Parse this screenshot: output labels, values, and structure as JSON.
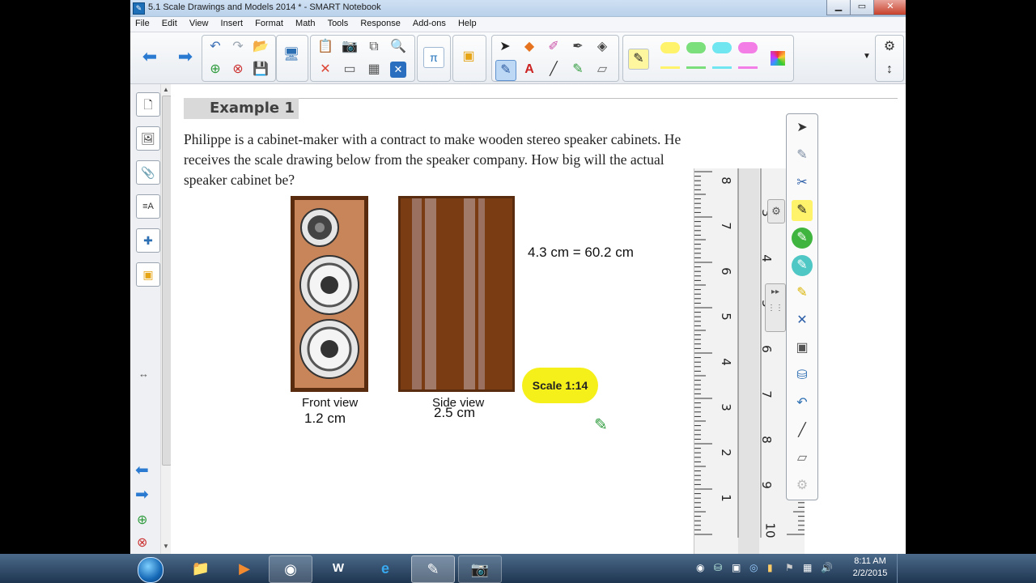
{
  "window": {
    "title": "5.1  Scale Drawings and Models 2014 * - SMART Notebook",
    "minimize": "▁",
    "restore": "▭",
    "close": "✕"
  },
  "menu": [
    "File",
    "Edit",
    "View",
    "Insert",
    "Format",
    "Math",
    "Tools",
    "Response",
    "Add-ons",
    "Help"
  ],
  "toolbar": {
    "math_icon_label": "π"
  },
  "page": {
    "example_label": "Example 1",
    "paragraph": "Philippe is a cabinet-maker with a contract to make wooden stereo speaker cabinets. He receives the scale drawing below from the speaker company. How big will the actual speaker cabinet be?",
    "front_caption": "Front view",
    "side_caption": "Side view",
    "front_note": "1.2 cm",
    "side_note": "2.5 cm",
    "equation_note": "4.3 cm = 60.2 cm",
    "scale_label": "Scale 1:14"
  },
  "ruler": {
    "numbers_left": [
      "8",
      "7",
      "6",
      "5",
      "4",
      "3",
      "2",
      "1"
    ],
    "numbers_right": [
      "3",
      "4",
      "5",
      "6",
      "7",
      "8",
      "9",
      "10"
    ]
  },
  "colors": {
    "cabinet_wood": "#c8855a",
    "cabinet_frame": "#5a2c0f",
    "side_wood": "#7a3c12",
    "scale_highlight": "#f6f01a",
    "toolbar_blue": "#1d6fb8"
  },
  "taskbar": {
    "clock_time": "8:11 AM",
    "clock_date": "2/2/2015"
  }
}
